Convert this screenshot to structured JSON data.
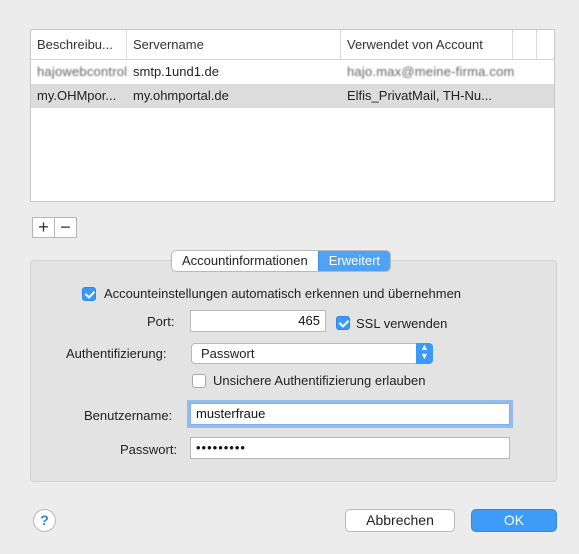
{
  "table": {
    "headers": [
      "Beschreibu...",
      "Servername",
      "Verwendet von Account"
    ],
    "rows": [
      {
        "description": "hajowebcontrol",
        "server": "smtp.1und1.de",
        "account": "hajo.max@meine-firma.com",
        "blurred": true
      },
      {
        "description": "my.OHMpor...",
        "server": "my.ohmportal.de",
        "account": "Elfis_PrivatMail, TH-Nu...",
        "blurred": false
      }
    ]
  },
  "controls": {
    "add": "+",
    "remove": "−"
  },
  "tabs": {
    "info": "Accountinformationen",
    "advanced": "Erweitert"
  },
  "settings": {
    "auto_detect": "Accounteinstellungen automatisch erkennen und übernehmen",
    "port_label": "Port:",
    "port_value": "465",
    "ssl_label": "SSL verwenden",
    "auth_label": "Authentifizierung:",
    "auth_value": "Passwort",
    "insecure_label": "Unsichere Authentifizierung erlauben",
    "user_label": "Benutzername:",
    "user_value": "musterfraue",
    "pass_label": "Passwort:",
    "pass_value": "•••••••••"
  },
  "footer": {
    "help": "?",
    "cancel": "Abbrechen",
    "ok": "OK"
  },
  "colors": {
    "accent": "#3b99fc"
  }
}
